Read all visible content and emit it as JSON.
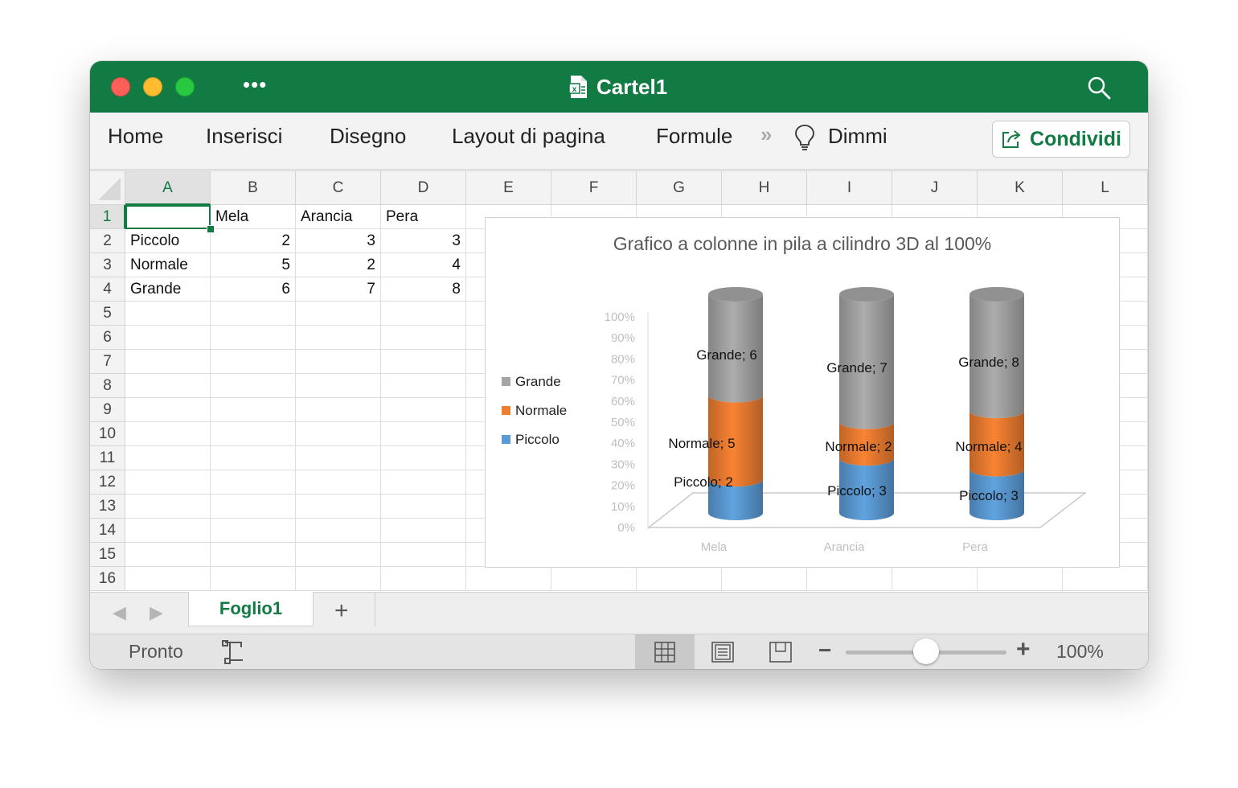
{
  "window": {
    "title": "Cartel1",
    "more_label": "•••"
  },
  "ribbon": {
    "tabs": [
      "Home",
      "Inserisci",
      "Disegno",
      "Layout di pagina",
      "Formule"
    ],
    "overflow": "»",
    "tell_me": "Dimmi",
    "share": "Condividi"
  },
  "grid": {
    "columns": [
      "A",
      "B",
      "C",
      "D",
      "E",
      "F",
      "G",
      "H",
      "I",
      "J",
      "K",
      "L"
    ],
    "rows": [
      "1",
      "2",
      "3",
      "4",
      "5",
      "6",
      "7",
      "8",
      "9",
      "10",
      "11",
      "12",
      "13",
      "14",
      "15",
      "16"
    ],
    "cells": {
      "B1": "Mela",
      "C1": "Arancia",
      "D1": "Pera",
      "A2": "Piccolo",
      "B2": "2",
      "C2": "3",
      "D2": "3",
      "A3": "Normale",
      "B3": "5",
      "C3": "2",
      "D3": "4",
      "A4": "Grande",
      "B4": "6",
      "C4": "7",
      "D4": "8"
    },
    "active_cell": "A1"
  },
  "chart_data": {
    "type": "bar",
    "variant": "3d-cylinder-stacked-100",
    "title": "Grafico a colonne in pila a cilindro 3D al 100%",
    "categories": [
      "Mela",
      "Arancia",
      "Pera"
    ],
    "series": [
      {
        "name": "Piccolo",
        "values": [
          2,
          3,
          3
        ],
        "color": "#5b9bd5"
      },
      {
        "name": "Normale",
        "values": [
          5,
          2,
          4
        ],
        "color": "#ed7d31"
      },
      {
        "name": "Grande",
        "values": [
          6,
          7,
          8
        ],
        "color": "#a5a5a5"
      }
    ],
    "data_labels": [
      [
        "Piccolo; 2",
        "Piccolo; 3",
        "Piccolo; 3"
      ],
      [
        "Normale; 5",
        "Normale; 2",
        "Normale; 4"
      ],
      [
        "Grande; 6",
        "Grande; 7",
        "Grande; 8"
      ]
    ],
    "yticks": [
      "0%",
      "10%",
      "20%",
      "30%",
      "40%",
      "50%",
      "60%",
      "70%",
      "80%",
      "90%",
      "100%"
    ],
    "ylim": [
      0,
      100
    ],
    "legend": "left",
    "legend_order": [
      "Grande",
      "Normale",
      "Piccolo"
    ]
  },
  "sheets": {
    "tabs": [
      "Foglio1"
    ],
    "add": "+",
    "prev": "◀",
    "next": "▶"
  },
  "status": {
    "ready": "Pronto",
    "zoom_minus": "−",
    "zoom_plus": "+",
    "zoom": "100%",
    "zoom_level": 1.0
  }
}
